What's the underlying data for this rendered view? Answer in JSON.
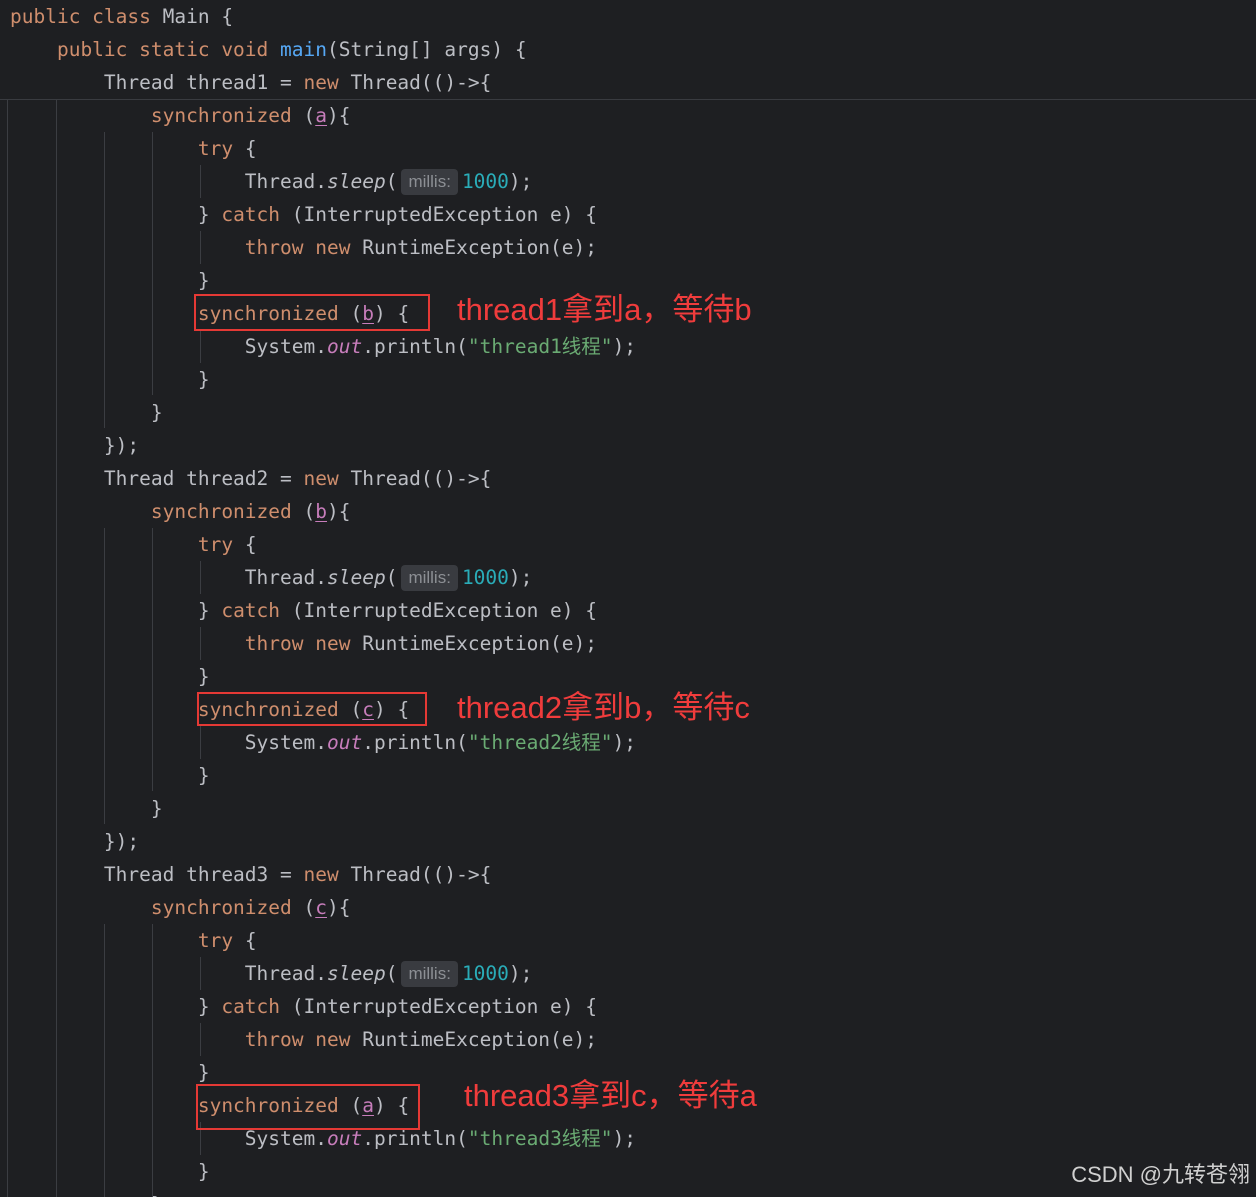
{
  "editor": {
    "colors": {
      "background": "#1e1f22",
      "default_text": "#bcbec4",
      "keyword": "#cf8e6d",
      "method": "#56a8f5",
      "number": "#2aacb8",
      "string": "#6aab73",
      "field_or_var": "#c77dbb",
      "annotation": "#f03c3c"
    },
    "lines": [
      [
        {
          "t": "public class ",
          "c": "kw"
        },
        {
          "t": "Main {",
          "c": "pl"
        }
      ],
      [
        {
          "t": "    public static void ",
          "c": "kw"
        },
        {
          "t": "main",
          "c": "fn"
        },
        {
          "t": "(String[] args) {",
          "c": "pl"
        }
      ],
      [
        {
          "t": "        Thread thread1 = ",
          "c": "pl"
        },
        {
          "t": "new ",
          "c": "kw"
        },
        {
          "t": "Thread(()->{",
          "c": "pl"
        }
      ],
      [
        {
          "t": "            synchronized ",
          "c": "kw"
        },
        {
          "t": "(",
          "c": "pl"
        },
        {
          "t": "a",
          "c": "var"
        },
        {
          "t": "){",
          "c": "pl"
        }
      ],
      [
        {
          "t": "                try ",
          "c": "kw"
        },
        {
          "t": "{",
          "c": "pl"
        }
      ],
      [
        {
          "t": "                    Thread.",
          "c": "pl"
        },
        {
          "t": "sleep",
          "c": "it"
        },
        {
          "t": "(",
          "c": "pl"
        },
        {
          "t": "millis:",
          "c": "hint"
        },
        {
          "t": "1000",
          "c": "num"
        },
        {
          "t": ");",
          "c": "pl"
        }
      ],
      [
        {
          "t": "                } ",
          "c": "pl"
        },
        {
          "t": "catch ",
          "c": "kw"
        },
        {
          "t": "(InterruptedException e) {",
          "c": "pl"
        }
      ],
      [
        {
          "t": "                    throw new ",
          "c": "kw"
        },
        {
          "t": "RuntimeException(e);",
          "c": "pl"
        }
      ],
      [
        {
          "t": "                }",
          "c": "pl"
        }
      ],
      [
        {
          "t": "                synchronized ",
          "c": "kw"
        },
        {
          "t": "(",
          "c": "pl"
        },
        {
          "t": "b",
          "c": "var"
        },
        {
          "t": ") {",
          "c": "pl"
        }
      ],
      [
        {
          "t": "                    System.",
          "c": "pl"
        },
        {
          "t": "out",
          "c": "st"
        },
        {
          "t": ".println(",
          "c": "pl"
        },
        {
          "t": "\"thread1线程\"",
          "c": "str"
        },
        {
          "t": ");",
          "c": "pl"
        }
      ],
      [
        {
          "t": "                }",
          "c": "pl"
        }
      ],
      [
        {
          "t": "            }",
          "c": "pl"
        }
      ],
      [
        {
          "t": "        });",
          "c": "pl"
        }
      ],
      [
        {
          "t": "        Thread thread2 = ",
          "c": "pl"
        },
        {
          "t": "new ",
          "c": "kw"
        },
        {
          "t": "Thread(()->{",
          "c": "pl"
        }
      ],
      [
        {
          "t": "            synchronized ",
          "c": "kw"
        },
        {
          "t": "(",
          "c": "pl"
        },
        {
          "t": "b",
          "c": "var"
        },
        {
          "t": "){",
          "c": "pl"
        }
      ],
      [
        {
          "t": "                try ",
          "c": "kw"
        },
        {
          "t": "{",
          "c": "pl"
        }
      ],
      [
        {
          "t": "                    Thread.",
          "c": "pl"
        },
        {
          "t": "sleep",
          "c": "it"
        },
        {
          "t": "(",
          "c": "pl"
        },
        {
          "t": "millis:",
          "c": "hint"
        },
        {
          "t": "1000",
          "c": "num"
        },
        {
          "t": ");",
          "c": "pl"
        }
      ],
      [
        {
          "t": "                } ",
          "c": "pl"
        },
        {
          "t": "catch ",
          "c": "kw"
        },
        {
          "t": "(InterruptedException e) {",
          "c": "pl"
        }
      ],
      [
        {
          "t": "                    throw new ",
          "c": "kw"
        },
        {
          "t": "RuntimeException(e);",
          "c": "pl"
        }
      ],
      [
        {
          "t": "                }",
          "c": "pl"
        }
      ],
      [
        {
          "t": "                synchronized ",
          "c": "kw"
        },
        {
          "t": "(",
          "c": "pl"
        },
        {
          "t": "c",
          "c": "var"
        },
        {
          "t": ") {",
          "c": "pl"
        }
      ],
      [
        {
          "t": "                    System.",
          "c": "pl"
        },
        {
          "t": "out",
          "c": "st"
        },
        {
          "t": ".println(",
          "c": "pl"
        },
        {
          "t": "\"thread2线程\"",
          "c": "str"
        },
        {
          "t": ");",
          "c": "pl"
        }
      ],
      [
        {
          "t": "                }",
          "c": "pl"
        }
      ],
      [
        {
          "t": "            }",
          "c": "pl"
        }
      ],
      [
        {
          "t": "        });",
          "c": "pl"
        }
      ],
      [
        {
          "t": "        Thread thread3 = ",
          "c": "pl"
        },
        {
          "t": "new ",
          "c": "kw"
        },
        {
          "t": "Thread(()->{",
          "c": "pl"
        }
      ],
      [
        {
          "t": "            synchronized ",
          "c": "kw"
        },
        {
          "t": "(",
          "c": "pl"
        },
        {
          "t": "c",
          "c": "var"
        },
        {
          "t": "){",
          "c": "pl"
        }
      ],
      [
        {
          "t": "                try ",
          "c": "kw"
        },
        {
          "t": "{",
          "c": "pl"
        }
      ],
      [
        {
          "t": "                    Thread.",
          "c": "pl"
        },
        {
          "t": "sleep",
          "c": "it"
        },
        {
          "t": "(",
          "c": "pl"
        },
        {
          "t": "millis:",
          "c": "hint"
        },
        {
          "t": "1000",
          "c": "num"
        },
        {
          "t": ");",
          "c": "pl"
        }
      ],
      [
        {
          "t": "                } ",
          "c": "pl"
        },
        {
          "t": "catch ",
          "c": "kw"
        },
        {
          "t": "(InterruptedException e) {",
          "c": "pl"
        }
      ],
      [
        {
          "t": "                    throw new ",
          "c": "kw"
        },
        {
          "t": "RuntimeException(e);",
          "c": "pl"
        }
      ],
      [
        {
          "t": "                }",
          "c": "pl"
        }
      ],
      [
        {
          "t": "                synchronized ",
          "c": "kw"
        },
        {
          "t": "(",
          "c": "pl"
        },
        {
          "t": "a",
          "c": "var"
        },
        {
          "t": ") {",
          "c": "pl"
        }
      ],
      [
        {
          "t": "                    System.",
          "c": "pl"
        },
        {
          "t": "out",
          "c": "st"
        },
        {
          "t": ".println(",
          "c": "pl"
        },
        {
          "t": "\"thread3线程\"",
          "c": "str"
        },
        {
          "t": ");",
          "c": "pl"
        }
      ],
      [
        {
          "t": "                }",
          "c": "pl"
        }
      ],
      [
        {
          "t": "            }",
          "c": "pl"
        }
      ]
    ]
  },
  "annotations": {
    "thread1": "thread1拿到a，等待b",
    "thread2": "thread2拿到b，等待c",
    "thread3": "thread3拿到c，等待a"
  },
  "watermark": "CSDN @九转苍翎"
}
